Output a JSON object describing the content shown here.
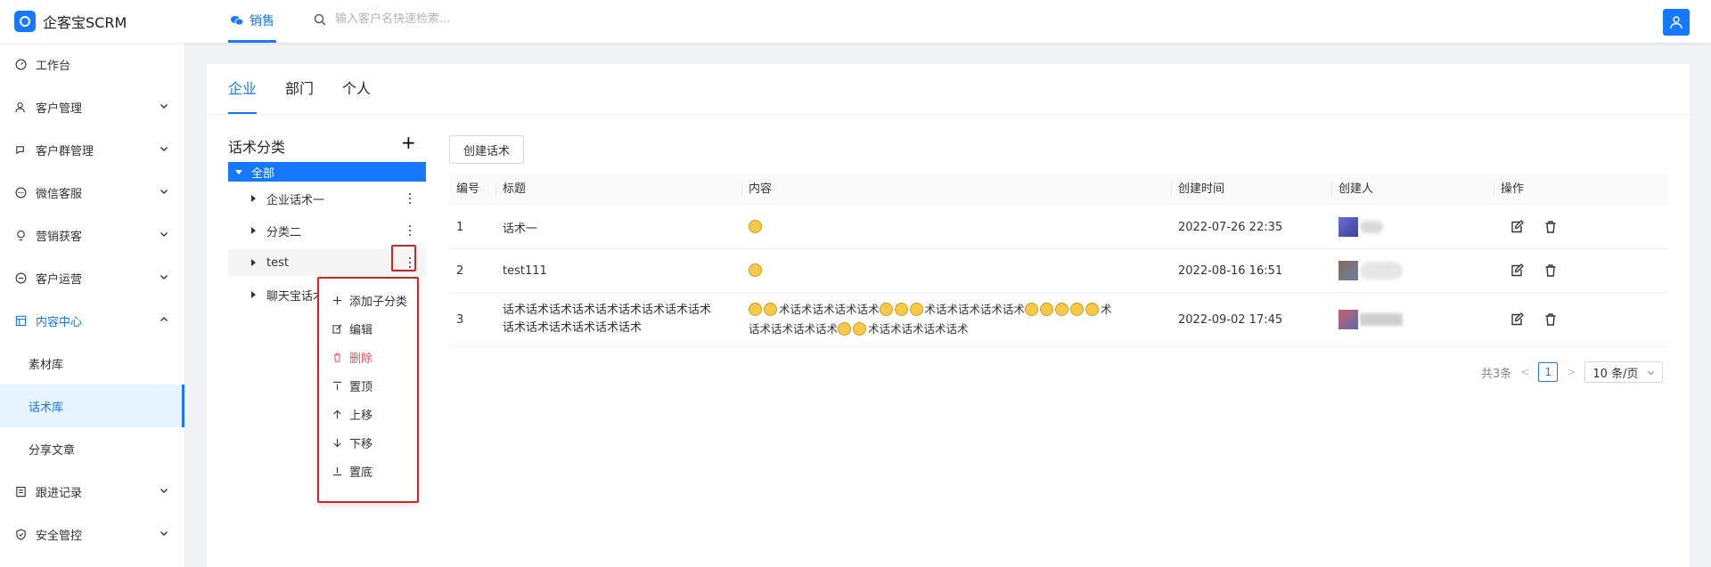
{
  "app": {
    "title": "企客宝SCRM",
    "top_nav": "销售",
    "search_placeholder": "输入客户名快速检索..."
  },
  "sidebar": {
    "items": [
      {
        "label": "工作台",
        "icon": "dashboard-icon"
      },
      {
        "label": "客户管理",
        "icon": "customer-icon"
      },
      {
        "label": "客户群管理",
        "icon": "group-chat-icon"
      },
      {
        "label": "微信客服",
        "icon": "service-icon"
      },
      {
        "label": "营销获客",
        "icon": "bulb-icon"
      },
      {
        "label": "客户运营",
        "icon": "operate-icon"
      },
      {
        "label": "内容中心",
        "icon": "content-icon"
      },
      {
        "label": "跟进记录",
        "icon": "record-icon"
      },
      {
        "label": "安全管控",
        "icon": "shield-icon"
      }
    ],
    "sub_items": [
      "素材库",
      "话术库",
      "分享文章"
    ]
  },
  "tabs": [
    "企业",
    "部门",
    "个人"
  ],
  "category": {
    "title": "话术分类",
    "root": "全部",
    "children": [
      "企业话术一",
      "分类二",
      "test",
      "聊天宝话术"
    ]
  },
  "dropdown": [
    "添加子分类",
    "编辑",
    "删除",
    "置顶",
    "上移",
    "下移",
    "置底"
  ],
  "toolbar": {
    "create_label": "创建话术"
  },
  "table": {
    "headers": [
      "编号",
      "标题",
      "内容",
      "创建时间",
      "创建人",
      "操作"
    ],
    "rows": [
      {
        "no": "1",
        "title": "话术一",
        "time": "2022-07-26 22:35",
        "creator_text": "缺省"
      },
      {
        "no": "2",
        "title": "test111",
        "time": "2022-08-16 16:51"
      },
      {
        "no": "3",
        "title_l1": "话术话术话术话术话术话术话术话术话术",
        "title_l2": "话术话术话术话术话术话术",
        "c_a": "术话术话术话术话术",
        "c_b": "术话术话术话术话术",
        "c_c": "术",
        "c_d": "话术话术话术话术",
        "c_e": "术话术话术话术话术",
        "time": "2022-09-02 17:45"
      }
    ]
  },
  "pagination": {
    "total": "共3条",
    "current": "1",
    "page_size": "10 条/页"
  },
  "colors": {
    "primary": "#1677ff",
    "danger": "#ff4d4f",
    "highlight": "#e02020"
  }
}
